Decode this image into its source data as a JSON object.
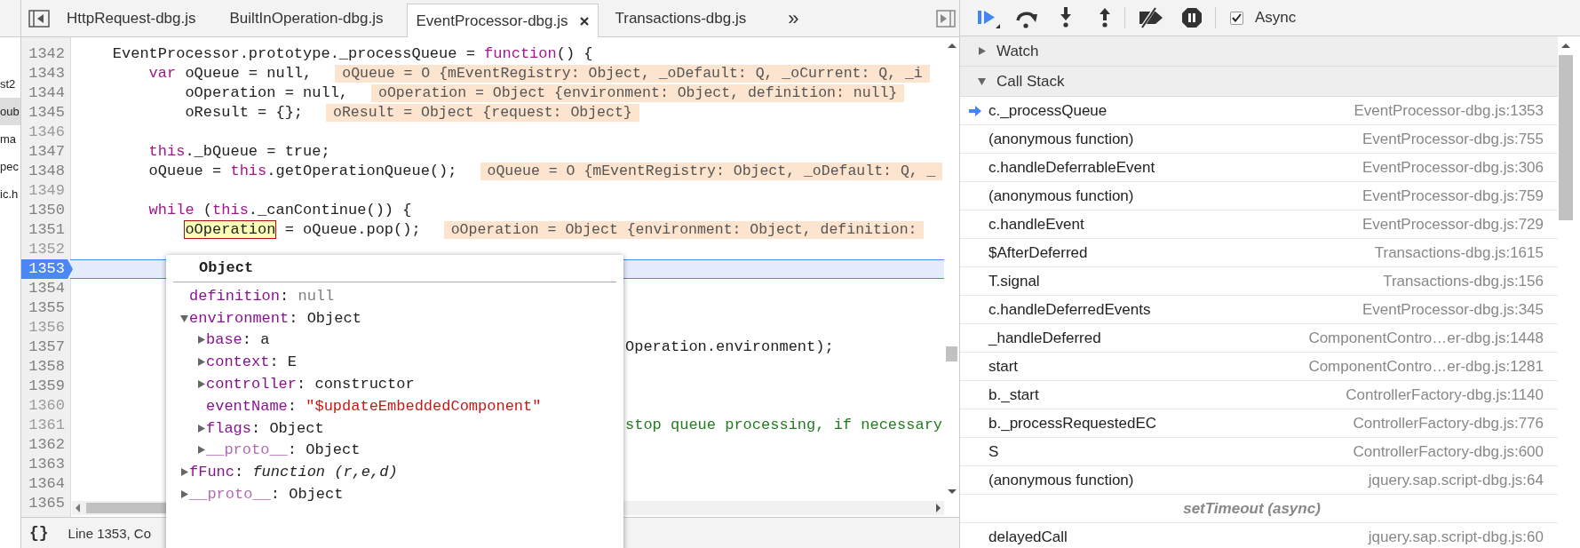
{
  "navigator": {
    "items": [
      {
        "label": "st2",
        "selected": false
      },
      {
        "label": "oub",
        "selected": true
      },
      {
        "label": "ma",
        "selected": false
      },
      {
        "label": "pec",
        "selected": false
      },
      {
        "label": "ic.h",
        "selected": false
      }
    ]
  },
  "editor_tabs": [
    {
      "label": "HttpRequest-dbg.js",
      "selected": false
    },
    {
      "label": "BuiltInOperation-dbg.js",
      "selected": false
    },
    {
      "label": "EventProcessor-dbg.js",
      "selected": true
    },
    {
      "label": "Transactions-dbg.js",
      "selected": false
    }
  ],
  "more_tabs": "»",
  "code": {
    "lines": [
      {
        "number": "1342",
        "muted": false,
        "current": false,
        "code": [
          {
            "kind": "plain",
            "text": "    EventProcessor.prototype._processQueue = "
          },
          {
            "kind": "keyword",
            "text": "function"
          },
          {
            "kind": "plain",
            "text": "() {"
          }
        ]
      },
      {
        "number": "1343",
        "muted": false,
        "current": false,
        "code": [
          {
            "kind": "keyword",
            "text": "        var"
          },
          {
            "kind": "plain",
            "text": " oQueue = null,"
          }
        ],
        "inline_value": "oQueue = O {mEventRegistry: Object, _oDefault: Q, _oCurrent: Q, _i"
      },
      {
        "number": "1344",
        "muted": false,
        "current": false,
        "code": [
          {
            "kind": "plain",
            "text": "            oOperation = null,"
          }
        ],
        "inline_value": "oOperation = Object {environment: Object, definition: null}"
      },
      {
        "number": "1345",
        "muted": false,
        "current": false,
        "code": [
          {
            "kind": "plain",
            "text": "            oResult = {};"
          }
        ],
        "inline_value": "oResult = Object {request: Object}"
      },
      {
        "number": "1346",
        "muted": true,
        "current": false
      },
      {
        "number": "1347",
        "muted": false,
        "current": false,
        "code": [
          {
            "kind": "keyword",
            "text": "        this"
          },
          {
            "kind": "plain",
            "text": "._bQueue = true;"
          }
        ]
      },
      {
        "number": "1348",
        "muted": false,
        "current": false,
        "code": [
          {
            "kind": "plain",
            "text": "        oQueue = "
          },
          {
            "kind": "keyword",
            "text": "this"
          },
          {
            "kind": "plain",
            "text": ".getOperationQueue();"
          }
        ],
        "inline_value": "oQueue = O {mEventRegistry: Object, _oDefault: Q, _"
      },
      {
        "number": "1349",
        "muted": true,
        "current": false
      },
      {
        "number": "1350",
        "muted": false,
        "current": false,
        "code": [
          {
            "kind": "keyword",
            "text": "        while"
          },
          {
            "kind": "plain",
            "text": " ("
          },
          {
            "kind": "keyword",
            "text": "this"
          },
          {
            "kind": "plain",
            "text": "._canContinue()) {"
          }
        ]
      },
      {
        "number": "1351",
        "muted": false,
        "current": false,
        "code": [
          {
            "kind": "highlight",
            "text": "            oOperation"
          },
          {
            "kind": "plain",
            "text": " = oQueue.pop();"
          }
        ],
        "inline_value": "oOperation = Object {environment: Object, definition:"
      },
      {
        "number": "1352",
        "muted": true,
        "current": false
      },
      {
        "number": "1353",
        "muted": false,
        "current": true
      },
      {
        "number": "1354",
        "muted": false,
        "current": false
      },
      {
        "number": "1355",
        "muted": false,
        "current": false
      },
      {
        "number": "1356",
        "muted": true,
        "current": false
      },
      {
        "number": "1357",
        "muted": false,
        "current": false,
        "tail": {
          "kind": "plain",
          "text": "Operation.environment);"
        }
      },
      {
        "number": "1358",
        "muted": false,
        "current": false
      },
      {
        "number": "1359",
        "muted": false,
        "current": false
      },
      {
        "number": "1360",
        "muted": true,
        "current": false
      },
      {
        "number": "1361",
        "muted": true,
        "current": false,
        "tail": {
          "kind": "comment",
          "text": "stop queue processing, if necessary"
        }
      },
      {
        "number": "1362",
        "muted": false,
        "current": false
      },
      {
        "number": "1363",
        "muted": false,
        "current": false
      },
      {
        "number": "1364",
        "muted": false,
        "current": false
      },
      {
        "number": "1365",
        "muted": false,
        "current": false
      }
    ]
  },
  "popover": {
    "title": "Object",
    "properties": [
      {
        "kind": "null",
        "key": "definition",
        "separator": ":",
        "value": "null",
        "internal": false
      },
      {
        "kind": "object",
        "key": "environment",
        "separator": ":",
        "value": "Object",
        "internal": false,
        "expanded": true,
        "children": [
          {
            "kind": "object",
            "key": "base",
            "separator": ":",
            "value": "a",
            "internal": false,
            "expanded": false
          },
          {
            "kind": "object",
            "key": "context",
            "separator": ":",
            "value": "E",
            "internal": false,
            "expanded": false
          },
          {
            "kind": "object",
            "key": "controller",
            "separator": ":",
            "value": "constructor",
            "internal": false,
            "expanded": false
          },
          {
            "kind": "string",
            "key": "eventName",
            "separator": ":",
            "value": "\"$updateEmbeddedComponent\"",
            "internal": false
          },
          {
            "kind": "object",
            "key": "flags",
            "separator": ":",
            "value": "Object",
            "internal": false,
            "expanded": false
          },
          {
            "kind": "object",
            "key": "__proto__",
            "separator": ":",
            "value": "Object",
            "internal": true,
            "expanded": false
          }
        ]
      },
      {
        "kind": "function",
        "key": "fFunc",
        "separator": ":",
        "value": "*function* (r,e,d)",
        "internal": false,
        "expanded": false
      },
      {
        "kind": "object",
        "key": "__proto__",
        "separator": ":",
        "value": "Object",
        "internal": true,
        "expanded": false
      }
    ]
  },
  "status_bar": {
    "pretty_print": "{}",
    "position": "Line 1353, Co"
  },
  "debugger": {
    "toolbar": {
      "async": {
        "label": "Async",
        "checked": true
      }
    },
    "sections": [
      {
        "title": "Watch",
        "expanded": false
      },
      {
        "title": "Call Stack",
        "expanded": true,
        "frames": [
          {
            "kind": "frame",
            "name": "c._processQueue",
            "location": "EventProcessor-dbg.js:1353",
            "current": true
          },
          {
            "kind": "frame",
            "name": "(anonymous function)",
            "location": "EventProcessor-dbg.js:755",
            "current": false
          },
          {
            "kind": "frame",
            "name": "c.handleDeferrableEvent",
            "location": "EventProcessor-dbg.js:306",
            "current": false
          },
          {
            "kind": "frame",
            "name": "(anonymous function)",
            "location": "EventProcessor-dbg.js:759",
            "current": false
          },
          {
            "kind": "frame",
            "name": "c.handleEvent",
            "location": "EventProcessor-dbg.js:729",
            "current": false
          },
          {
            "kind": "frame",
            "name": "$AfterDeferred",
            "location": "Transactions-dbg.js:1615",
            "current": false
          },
          {
            "kind": "frame",
            "name": "T.signal",
            "location": "Transactions-dbg.js:156",
            "current": false
          },
          {
            "kind": "frame",
            "name": "c.handleDeferredEvents",
            "location": "EventProcessor-dbg.js:345",
            "current": false
          },
          {
            "kind": "frame",
            "name": "_handleDeferred",
            "location": "ComponentContro…er-dbg.js:1448",
            "current": false
          },
          {
            "kind": "frame",
            "name": "start",
            "location": "ComponentContro…er-dbg.js:1281",
            "current": false
          },
          {
            "kind": "frame",
            "name": "b._start",
            "location": "ControllerFactory-dbg.js:1140",
            "current": false
          },
          {
            "kind": "frame",
            "name": "b._processRequestedEC",
            "location": "ControllerFactory-dbg.js:776",
            "current": false
          },
          {
            "kind": "frame",
            "name": "S",
            "location": "ControllerFactory-dbg.js:600",
            "current": false
          },
          {
            "kind": "frame",
            "name": "(anonymous function)",
            "location": "jquery.sap.script-dbg.js:64",
            "current": false
          },
          {
            "kind": "async",
            "label": "setTimeout (async)",
            "current": false
          },
          {
            "kind": "frame",
            "name": "delayedCall",
            "location": "jquery.sap.script-dbg.js:60",
            "current": false
          }
        ]
      }
    ]
  }
}
